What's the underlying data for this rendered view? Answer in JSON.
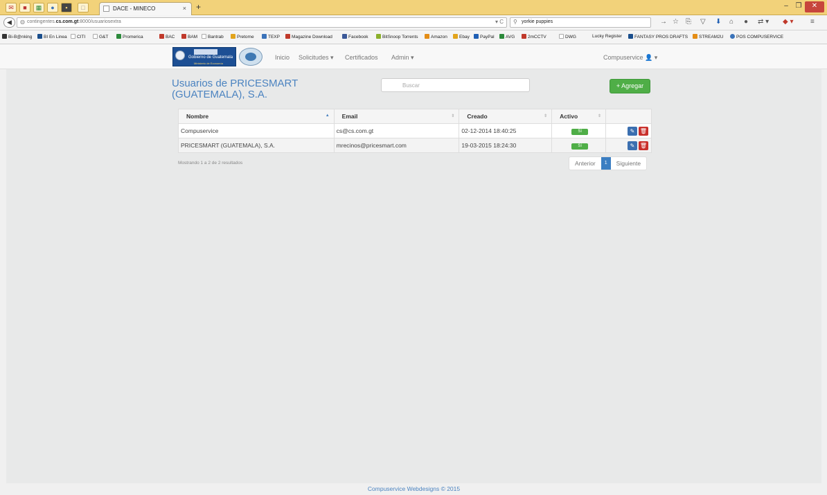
{
  "browser": {
    "tab_title": "DACE - MINECO",
    "tab_close": "×",
    "new_tab": "+",
    "url_prefix": "contingentes.",
    "url_domain": "cs.com.gt",
    "url_suffix": ":8000/usuariosextra",
    "search_text": "yorkie puppies"
  },
  "bookmarks": [
    {
      "label": "Bi-B@nking",
      "color": "#333333"
    },
    {
      "label": "BI En Linea",
      "color": "#1a4e8c"
    },
    {
      "label": "CITI",
      "color": "#cccccc"
    },
    {
      "label": "G&T",
      "color": "#cccccc"
    },
    {
      "label": "Promerica",
      "color": "#2c8a3b"
    },
    {
      "label": "BAC",
      "color": "#c0392b"
    },
    {
      "label": "BAM",
      "color": "#c0392b"
    },
    {
      "label": "Bantrab",
      "color": "#cccccc"
    },
    {
      "label": "Pretome",
      "color": "#e2a41c"
    },
    {
      "label": "TEXP",
      "color": "#3b73b9"
    },
    {
      "label": "Magazine Download",
      "color": "#c0392b"
    },
    {
      "label": "Facebook",
      "color": "#3b5998"
    },
    {
      "label": "BitSnoop Torrents",
      "color": "#8bb02b"
    },
    {
      "label": "Amazon",
      "color": "#e48d16"
    },
    {
      "label": "Ebay",
      "color": "#e2a41c"
    },
    {
      "label": "PayPal",
      "color": "#1f5fb4"
    },
    {
      "label": "AVG",
      "color": "#2c8a3b"
    },
    {
      "label": "2mCCTV",
      "color": "#c0392b"
    },
    {
      "label": "DWG",
      "color": "#cccccc"
    },
    {
      "label": "Lucky Register",
      "color": "#f4f4f4"
    },
    {
      "label": "FANTASY PROS DRAFTS",
      "color": "#1a4e8c"
    },
    {
      "label": "STREAM2U",
      "color": "#e48d16"
    },
    {
      "label": "POS COMPUSERVICE",
      "color": "#3b73b9"
    }
  ],
  "app": {
    "logo_text": "Gobierno de Guatemala",
    "logo_sub": "Ministerio de Economía",
    "menu": {
      "inicio": "Inicio",
      "solicitudes": "Solicitudes ▾",
      "certificados": "Certificados",
      "admin": "Admin ▾"
    },
    "user": "Compuservice 👤 ▾"
  },
  "page": {
    "title": "Usuarios de PRICESMART (GUATEMALA), S.A.",
    "search_placeholder": "Buscar",
    "add_label": "+ Agregar",
    "columns": [
      "Nombre",
      "Email",
      "Creado",
      "Activo",
      ""
    ],
    "rows": [
      {
        "nombre": "Compuservice",
        "email": "cs@cs.com.gt",
        "creado": "02-12-2014 18:40:25",
        "activo": "Sí"
      },
      {
        "nombre": "PRICESMART (GUATEMALA), S.A.",
        "email": "mrecinos@pricesmart.com",
        "creado": "19-03-2015 18:24:30",
        "activo": "Sí"
      }
    ],
    "info": "Mostrando 1 a 2 de 2 resultados",
    "pager": {
      "prev": "Anterior",
      "current": "1",
      "next": "Siguiente"
    }
  },
  "footer": {
    "link": "Compuservice Webdesigns",
    "suffix": " © 2015"
  },
  "colors": {
    "accent": "#4b83c0",
    "success": "#4fae47",
    "danger": "#c9302c"
  }
}
